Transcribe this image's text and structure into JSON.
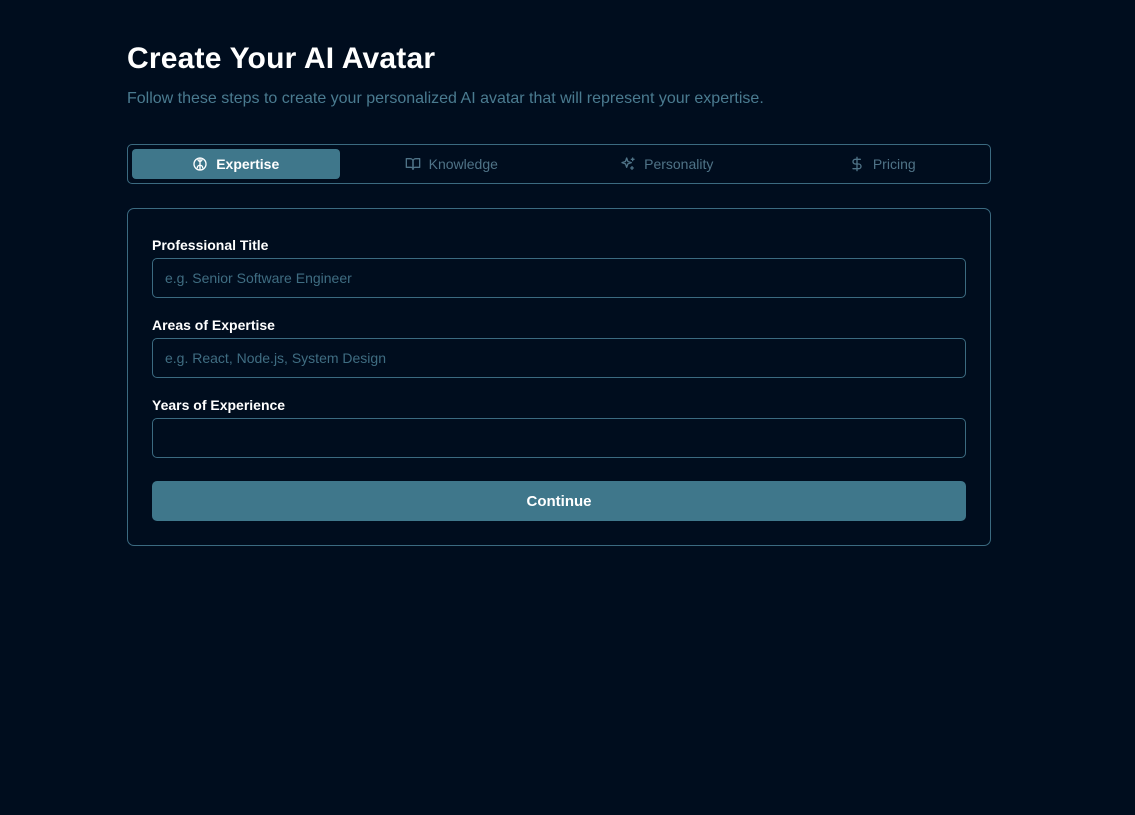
{
  "header": {
    "title": "Create Your AI Avatar",
    "subtitle": "Follow these steps to create your personalized AI avatar that will represent your expertise."
  },
  "tabs": [
    {
      "label": "Expertise",
      "icon": "brain-icon",
      "active": true
    },
    {
      "label": "Knowledge",
      "icon": "book-open-icon",
      "active": false
    },
    {
      "label": "Personality",
      "icon": "sparkles-icon",
      "active": false
    },
    {
      "label": "Pricing",
      "icon": "dollar-icon",
      "active": false
    }
  ],
  "form": {
    "professional_title": {
      "label": "Professional Title",
      "placeholder": "e.g. Senior Software Engineer",
      "value": ""
    },
    "areas_of_expertise": {
      "label": "Areas of Expertise",
      "placeholder": "e.g. React, Node.js, System Design",
      "value": ""
    },
    "years_of_experience": {
      "label": "Years of Experience",
      "placeholder": "",
      "value": ""
    },
    "continue_label": "Continue"
  },
  "colors": {
    "background": "#000d1e",
    "accent": "#3f778b",
    "border": "#3b6a80",
    "muted_text": "#4a7b90"
  }
}
